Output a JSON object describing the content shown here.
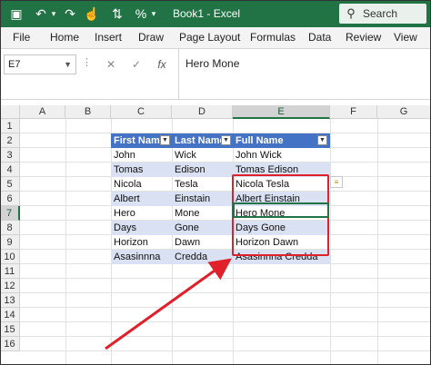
{
  "app": {
    "title": "Book1 - Excel",
    "search_label": "Search",
    "accent": "#217346"
  },
  "ribbon": {
    "tabs": [
      "File",
      "Home",
      "Insert",
      "Draw",
      "Page Layout",
      "Formulas",
      "Data",
      "Review",
      "View"
    ]
  },
  "formula_bar": {
    "name_box": "E7",
    "cancel_glyph": "✕",
    "enter_glyph": "✓",
    "fx_label": "fx",
    "value": "Hero Mone"
  },
  "grid": {
    "columns": [
      "A",
      "B",
      "C",
      "D",
      "E",
      "F",
      "G"
    ],
    "rows": [
      "1",
      "2",
      "3",
      "4",
      "5",
      "6",
      "7",
      "8",
      "9",
      "10",
      "11",
      "12",
      "13",
      "14",
      "15",
      "16"
    ],
    "active_cell": "E7"
  },
  "table": {
    "headers": [
      "First Name",
      "Last Name",
      "Full Name"
    ],
    "rows": [
      [
        "John",
        "Wick",
        "John Wick"
      ],
      [
        "Tomas",
        "Edison",
        "Tomas Edison"
      ],
      [
        "Nicola",
        "Tesla",
        "Nicola Tesla"
      ],
      [
        "Albert",
        "Einstain",
        "Albert Einstain"
      ],
      [
        "Hero",
        "Mone",
        "Hero Mone"
      ],
      [
        "Days",
        "Gone",
        "Days Gone"
      ],
      [
        "Horizon",
        "Dawn",
        "Horizon Dawn"
      ],
      [
        "Asasinnna",
        "Credda",
        "Asasinnna Credda"
      ]
    ],
    "header_color": "#4472c4",
    "band_color": "#d9e1f2"
  },
  "annotation": {
    "highlight_color": "#e0202a"
  }
}
